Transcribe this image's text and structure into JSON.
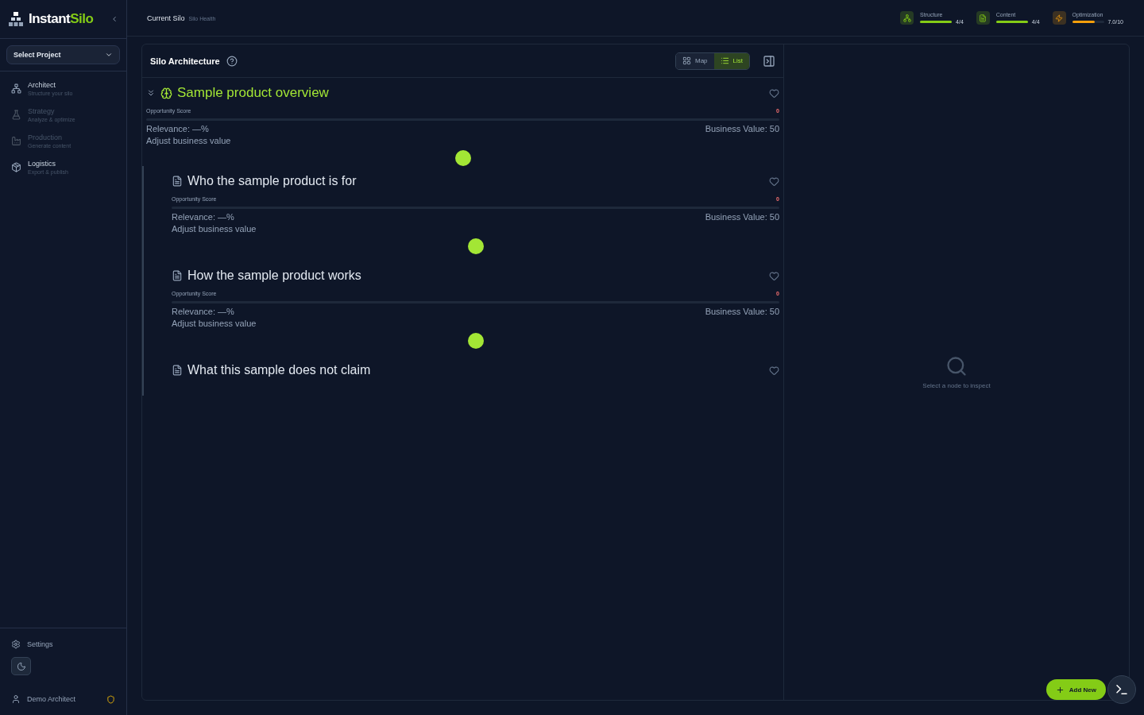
{
  "brand": {
    "name": "Instant",
    "accent": "Silo"
  },
  "project_select": {
    "value": "Select Project"
  },
  "nav": [
    {
      "label": "Architect",
      "sub": "Structure your silo",
      "disabled": false
    },
    {
      "label": "Strategy",
      "sub": "Analyze & optimize",
      "disabled": true
    },
    {
      "label": "Production",
      "sub": "Generate content",
      "disabled": true
    },
    {
      "label": "Logistics",
      "sub": "Export & publish",
      "disabled": false
    }
  ],
  "settings": {
    "label": "Settings"
  },
  "user": {
    "name": "Demo Architect"
  },
  "breadcrumb": {
    "current": "Current Silo",
    "sub": "Silo Health"
  },
  "metrics": [
    {
      "label": "Structure",
      "value": "4/4",
      "level": 1,
      "color": "#84cc16"
    },
    {
      "label": "Content",
      "value": "4/4",
      "level": 1,
      "color": "#84cc16"
    },
    {
      "label": "Optimization",
      "value": "7.0/10",
      "level": 0.7,
      "color": "#f59e0b"
    }
  ],
  "panel": {
    "title": "Silo Architecture"
  },
  "view_tabs": [
    {
      "label": "Map",
      "selected": false
    },
    {
      "label": "List",
      "selected": true
    }
  ],
  "tree": {
    "title": "Sample product overview",
    "expanded": true,
    "opportunity_label": "Opportunity Score",
    "opportunity": "0",
    "relevance": "Relevance: —%",
    "business": "Business Value: 50",
    "adjust": "Adjust business value",
    "level": 0.5,
    "children": [
      {
        "title": "Who the sample product is for",
        "opportunity_label": "Opportunity Score",
        "opportunity": "0",
        "relevance": "Relevance: —%",
        "business": "Business Value: 50",
        "adjust": "Adjust business value",
        "level": 0.5
      },
      {
        "title": "How the sample product works",
        "opportunity_label": "Opportunity Score",
        "opportunity": "0",
        "relevance": "Relevance: —%",
        "business": "Business Value: 50",
        "adjust": "Adjust business value",
        "level": 0.5
      },
      {
        "title": "What this sample does not claim"
      }
    ]
  },
  "inspector": {
    "empty_text": "Select a node to inspect"
  },
  "add_button": {
    "label": "Add New"
  }
}
